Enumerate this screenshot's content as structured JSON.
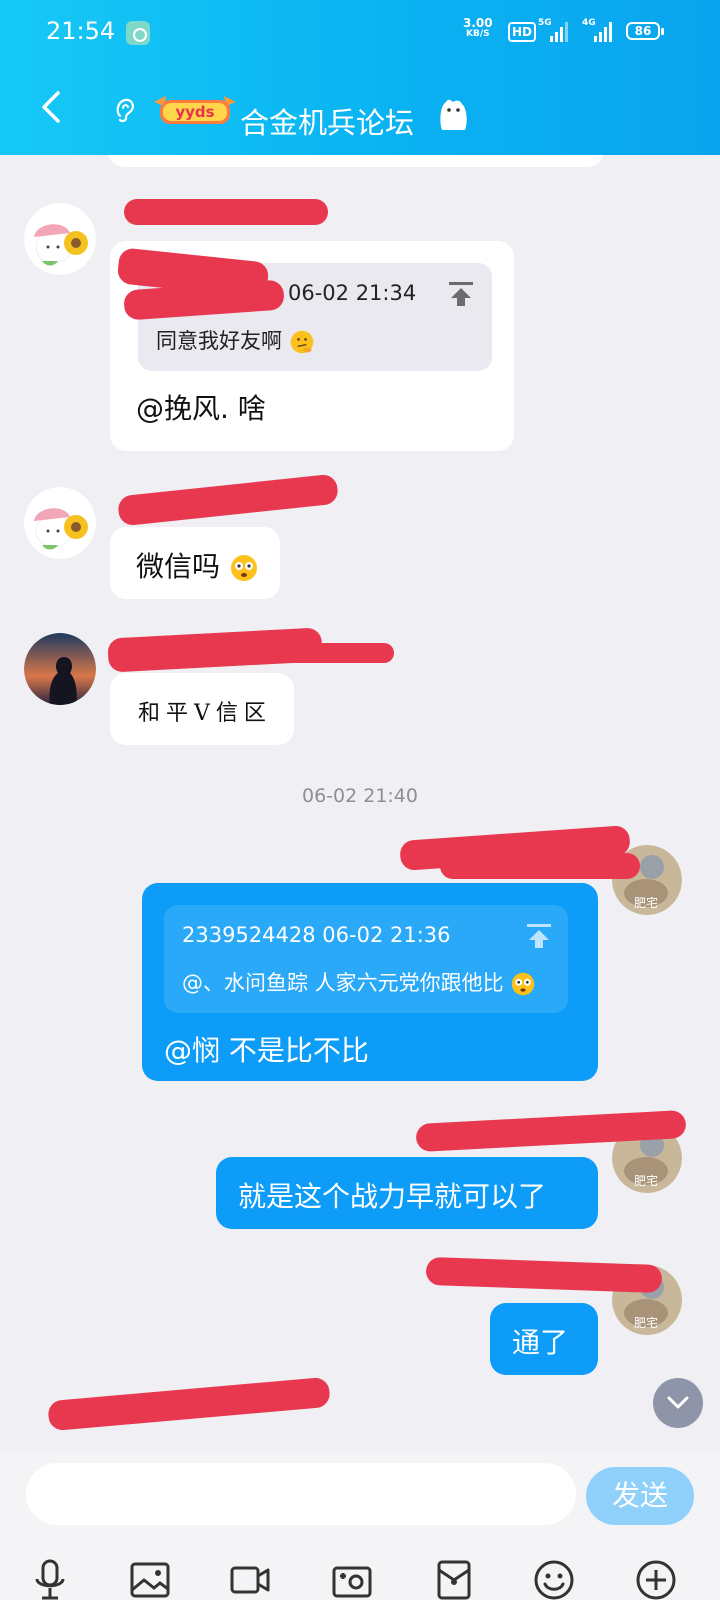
{
  "status_bar": {
    "time": "21:54",
    "net_speed": "3.00",
    "net_unit": "KB/S",
    "hd": "HD",
    "sim1": "5G",
    "sim2": "4G",
    "battery": "86"
  },
  "header": {
    "title": "合金机兵论坛",
    "badge_text": "yyds"
  },
  "messages": {
    "m1": {
      "quote_time": "06-02 21:34",
      "quote_text": "同意我好友啊",
      "text": "@挽风. 啥"
    },
    "m2": {
      "text": "微信吗"
    },
    "m3": {
      "text": "和平V信区"
    },
    "divider_time": "06-02 21:40",
    "m4": {
      "quote_header": "2339524428 06-02 21:36",
      "quote_text": "@、水问鱼踪 人家六元党你跟他比",
      "text": "@悯 不是比不比"
    },
    "m5": {
      "text": "就是这个战力早就可以了"
    },
    "m6": {
      "text": "通了"
    },
    "avatar_caption": "肥宅"
  },
  "composer": {
    "placeholder": "",
    "send_label": "发送"
  },
  "toolbar": {
    "icons": [
      "microphone-icon",
      "image-icon",
      "video-icon",
      "camera-icon",
      "red-packet-icon",
      "emoji-icon",
      "plus-icon"
    ]
  },
  "colors": {
    "header_gradient_start": "#16c9f6",
    "header_gradient_end": "#0aa4ee",
    "bubble_blue": "#0d9cf7",
    "send_button": "#8fd1fb",
    "redaction": "#e8384f"
  }
}
